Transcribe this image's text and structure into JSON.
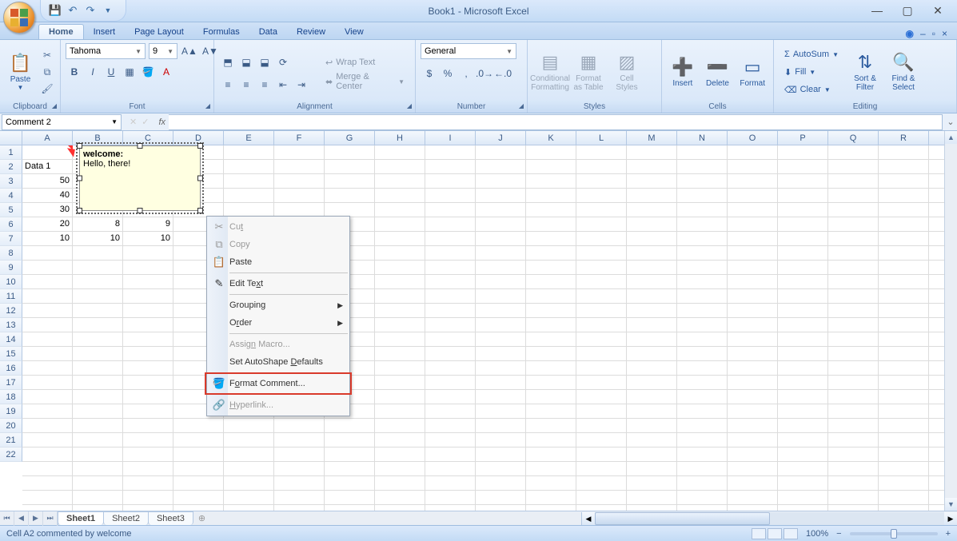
{
  "title": "Book1 - Microsoft Excel",
  "qat": {
    "save": "💾",
    "undo": "↶",
    "redo": "↷"
  },
  "tabs": [
    "Home",
    "Insert",
    "Page Layout",
    "Formulas",
    "Data",
    "Review",
    "View"
  ],
  "active_tab": 0,
  "ribbon": {
    "clipboard": {
      "title": "Clipboard",
      "paste": "Paste"
    },
    "font": {
      "title": "Font",
      "name": "Tahoma",
      "size": "9",
      "bold": "B",
      "italic": "I",
      "underline": "U"
    },
    "alignment": {
      "title": "Alignment",
      "wrap": "Wrap Text",
      "merge": "Merge & Center"
    },
    "number": {
      "title": "Number",
      "format": "General"
    },
    "styles": {
      "title": "Styles",
      "cond": "Conditional Formatting",
      "fmt": "Format as Table",
      "cell": "Cell Styles"
    },
    "cells": {
      "title": "Cells",
      "insert": "Insert",
      "delete": "Delete",
      "format": "Format"
    },
    "editing": {
      "title": "Editing",
      "autosum": "AutoSum",
      "fill": "Fill",
      "clear": "Clear",
      "sort": "Sort & Filter",
      "find": "Find & Select"
    }
  },
  "namebox": "Comment 2",
  "formula": "",
  "cols": [
    "A",
    "B",
    "C",
    "D",
    "E",
    "F",
    "G",
    "H",
    "I",
    "J",
    "K",
    "L",
    "M",
    "N",
    "O",
    "P",
    "Q",
    "R"
  ],
  "rows_count": 22,
  "cells": {
    "A2": "Data 1",
    "A3": "50",
    "A4": "40",
    "A5": "30",
    "A6": "20",
    "A7": "10",
    "B6": "8",
    "B7": "10",
    "C6": "9",
    "C7": "10"
  },
  "comment": {
    "author": "welcome:",
    "text": "Hello, there!"
  },
  "context_menu": {
    "cut": "Cut",
    "copy": "Copy",
    "paste": "Paste",
    "edit": "Edit Text",
    "grouping": "Grouping",
    "order": "Order",
    "assign": "Assign Macro...",
    "defaults": "Set AutoShape Defaults",
    "format": "Format Comment...",
    "hyperlink": "Hyperlink..."
  },
  "sheets": [
    "Sheet1",
    "Sheet2",
    "Sheet3"
  ],
  "active_sheet": 0,
  "status_text": "Cell A2 commented by welcome",
  "zoom": "100%"
}
